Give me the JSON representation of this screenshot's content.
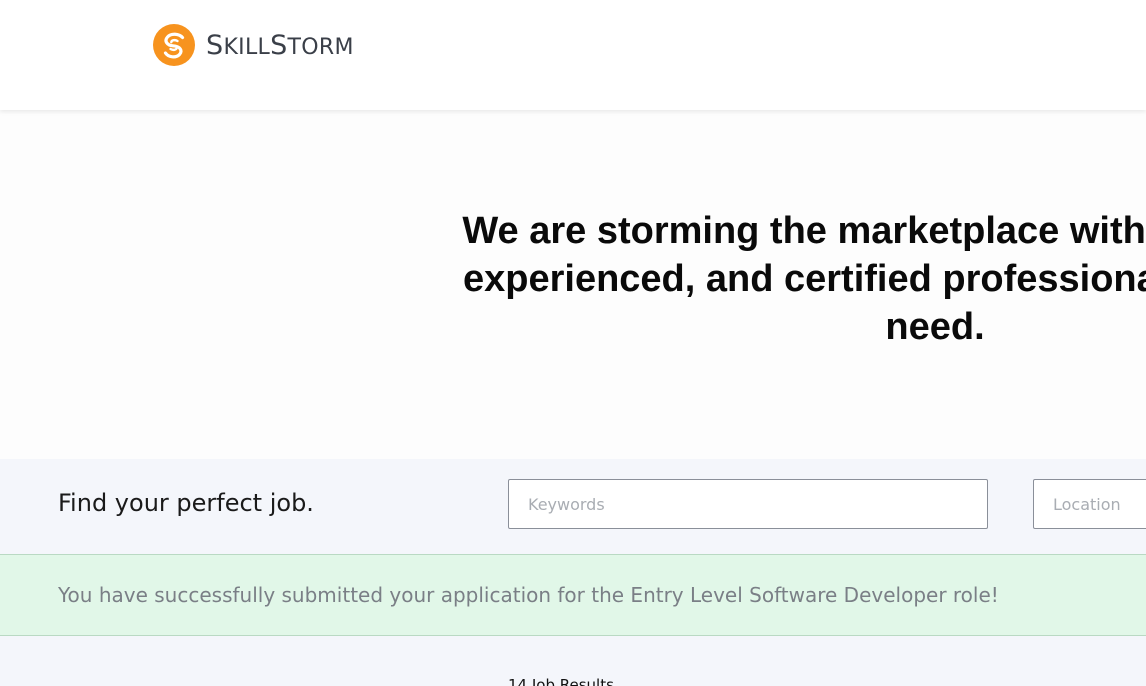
{
  "header": {
    "logo_text": "SkillStorm",
    "logo_icon": "skillstorm-swirl-icon",
    "brand_color": "#f7931e"
  },
  "hero": {
    "headline": "We are storming the marketplace with highly skilled, experienced, and certified professionals businesses need."
  },
  "search": {
    "title": "Find your perfect job.",
    "keywords_placeholder": "Keywords",
    "keywords_value": "",
    "location_placeholder": "Location",
    "location_value": ""
  },
  "alert": {
    "message": "You have successfully submitted your application for the Entry Level Software Developer role!",
    "background_color": "#e1f7e8"
  },
  "results": {
    "count_label": "14 Job Results"
  }
}
